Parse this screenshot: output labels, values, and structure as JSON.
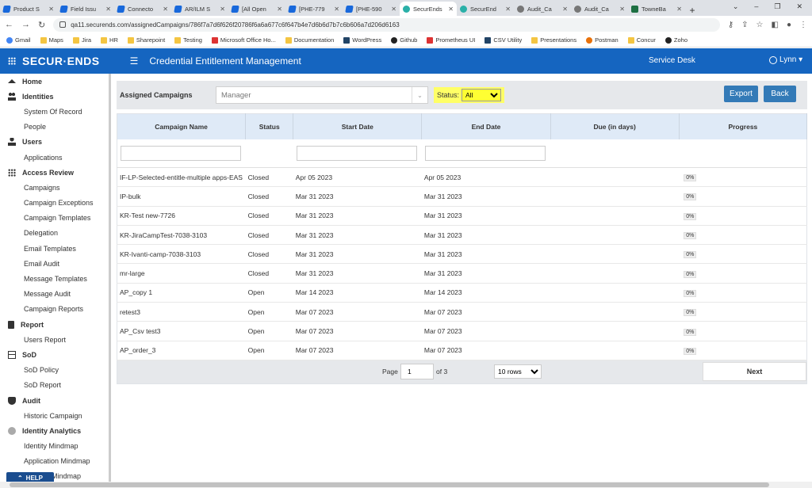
{
  "browser": {
    "tabs": [
      {
        "title": "Product S",
        "icon": "confluence-icon"
      },
      {
        "title": "Field Issu",
        "icon": "confluence-icon"
      },
      {
        "title": "Connecto",
        "icon": "confluence-icon"
      },
      {
        "title": "AR/ILM S",
        "icon": "confluence-icon"
      },
      {
        "title": "[All Open",
        "icon": "confluence-icon"
      },
      {
        "title": "[PHE-779",
        "icon": "confluence-icon"
      },
      {
        "title": "[PHE-590",
        "icon": "confluence-icon"
      },
      {
        "title": "SecurEnds",
        "icon": "securends-icon",
        "active": true
      },
      {
        "title": "SecurEnd",
        "icon": "securends-icon"
      },
      {
        "title": "Audit_Ca",
        "icon": "globe-icon"
      },
      {
        "title": "Audit_Ca",
        "icon": "globe-icon"
      },
      {
        "title": "TowneBa",
        "icon": "excel-icon"
      }
    ],
    "new_tab": "+",
    "url": "qa11.securends.com/assignedCampaigns/786f7a7d6f626f20786f6a6a677c6f647b4e7d6b6d7b7c6b606a7d206d6163",
    "bookmarks": [
      "Gmail",
      "Maps",
      "Jira",
      "HR",
      "Sharepoint",
      "Testing",
      "Microsoft Office Ho...",
      "Documentation",
      "WordPress",
      "Github",
      "Prometheus UI",
      "CSV Utility",
      "Presentations",
      "Postman",
      "Concur",
      "Zoho"
    ]
  },
  "header": {
    "logo": "SECUR·ENDS",
    "title": "Credential Entitlement Management",
    "service_desk": "Service Desk",
    "user": "Lynn ▾"
  },
  "sidebar": [
    {
      "type": "section",
      "label": "Home",
      "icon": "home-icon"
    },
    {
      "type": "section",
      "label": "Identities",
      "icon": "users-icon"
    },
    {
      "type": "sub",
      "label": "System Of Record"
    },
    {
      "type": "sub",
      "label": "People"
    },
    {
      "type": "section",
      "label": "Users",
      "icon": "user-icon"
    },
    {
      "type": "sub",
      "label": "Applications"
    },
    {
      "type": "section",
      "label": "Access Review",
      "icon": "grid-icon"
    },
    {
      "type": "sub",
      "label": "Campaigns"
    },
    {
      "type": "sub",
      "label": "Campaign Exceptions"
    },
    {
      "type": "sub",
      "label": "Campaign Templates"
    },
    {
      "type": "sub",
      "label": "Delegation"
    },
    {
      "type": "sub",
      "label": "Email Templates"
    },
    {
      "type": "sub",
      "label": "Email Audit"
    },
    {
      "type": "sub",
      "label": "Message Templates"
    },
    {
      "type": "sub",
      "label": "Message Audit"
    },
    {
      "type": "sub",
      "label": "Campaign Reports"
    },
    {
      "type": "section",
      "label": "Report",
      "icon": "report-icon"
    },
    {
      "type": "sub",
      "label": "Users Report"
    },
    {
      "type": "section",
      "label": "SoD",
      "icon": "table-icon"
    },
    {
      "type": "sub",
      "label": "SoD Policy"
    },
    {
      "type": "sub",
      "label": "SoD Report"
    },
    {
      "type": "section",
      "label": "Audit",
      "icon": "shield-icon"
    },
    {
      "type": "sub",
      "label": "Historic Campaign"
    },
    {
      "type": "section",
      "label": "Identity Analytics",
      "icon": "analytics-icon"
    },
    {
      "type": "sub",
      "label": "Identity Mindmap"
    },
    {
      "type": "sub",
      "label": "Application Mindmap"
    },
    {
      "type": "sub",
      "label": "Account Mindmap"
    }
  ],
  "help_label": "HELP",
  "toolbar": {
    "label": "Assigned Campaigns",
    "manager_placeholder": "Manager",
    "status_label": "Status:",
    "status_value": "All",
    "export_label": "Export",
    "back_label": "Back"
  },
  "table": {
    "columns": [
      "Campaign Name",
      "Status",
      "Start Date",
      "End Date",
      "Due (in days)",
      "Progress"
    ],
    "rows": [
      [
        "IF-LP-Selected-entitle-multiple apps-EAS",
        "Closed",
        "Apr 05 2023",
        "Apr 05 2023",
        "",
        "0%"
      ],
      [
        "IP-bulk",
        "Closed",
        "Mar 31 2023",
        "Mar 31 2023",
        "",
        "0%"
      ],
      [
        "KR-Test new-7726",
        "Closed",
        "Mar 31 2023",
        "Mar 31 2023",
        "",
        "0%"
      ],
      [
        "KR-JiraCampTest-7038-3103",
        "Closed",
        "Mar 31 2023",
        "Mar 31 2023",
        "",
        "0%"
      ],
      [
        "KR-Ivanti-camp-7038-3103",
        "Closed",
        "Mar 31 2023",
        "Mar 31 2023",
        "",
        "0%"
      ],
      [
        "mr-large",
        "Closed",
        "Mar 31 2023",
        "Mar 31 2023",
        "",
        "0%"
      ],
      [
        "AP_copy 1",
        "Open",
        "Mar 14 2023",
        "Mar 14 2023",
        "",
        "0%"
      ],
      [
        "retest3",
        "Open",
        "Mar 07 2023",
        "Mar 07 2023",
        "",
        "0%"
      ],
      [
        "AP_Csv test3",
        "Open",
        "Mar 07 2023",
        "Mar 07 2023",
        "",
        "0%"
      ],
      [
        "AP_order_3",
        "Open",
        "Mar 07 2023",
        "Mar 07 2023",
        "",
        "0%"
      ]
    ]
  },
  "pager": {
    "page_label": "Page",
    "page_value": "1",
    "of_label": "of 3",
    "rows_option": "10 rows",
    "next_label": "Next"
  }
}
